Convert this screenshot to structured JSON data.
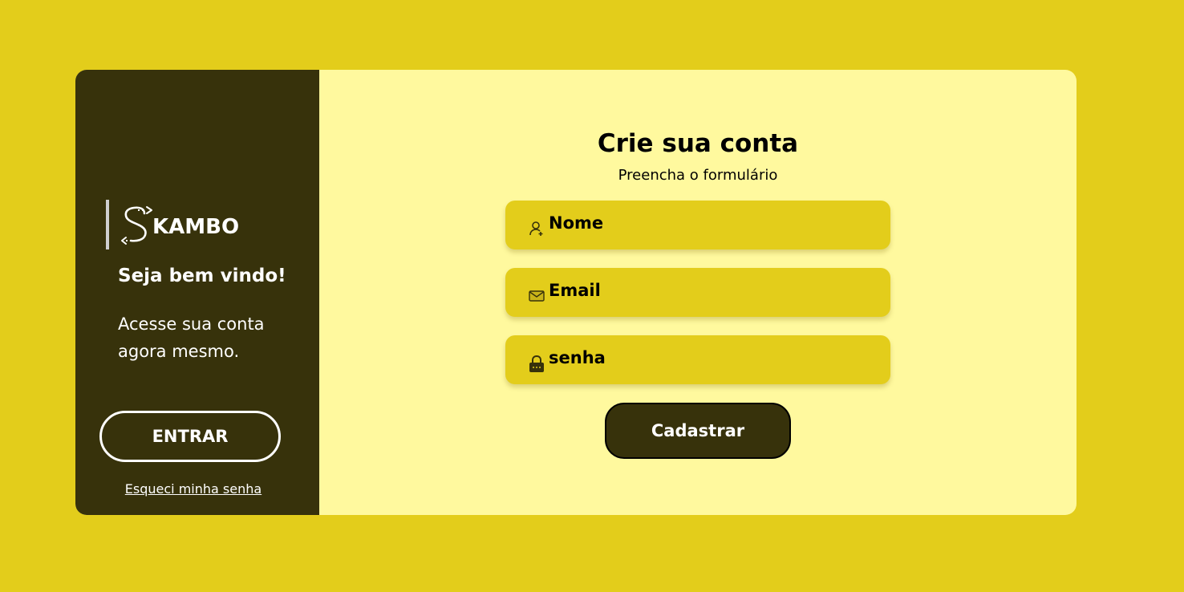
{
  "brand": {
    "logo_text": "KAMBO"
  },
  "left_panel": {
    "welcome": "Seja bem vindo!",
    "access_text": "Acesse sua conta agora mesmo.",
    "enter_label": "ENTRAR",
    "forgot_label": "Esqueci minha senha"
  },
  "form": {
    "title": "Crie sua conta",
    "subtitle": "Preencha o formulário",
    "name_placeholder": "Nome",
    "email_placeholder": "Email",
    "password_placeholder": "senha",
    "submit_label": "Cadastrar"
  },
  "colors": {
    "background": "#e3cd1b",
    "dark_panel": "#37320b",
    "form_panel": "#fff99e",
    "input_bg": "#e3cd1b"
  },
  "icons": {
    "name_field": "user-plus-icon",
    "email_field": "envelope-icon",
    "password_field": "lock-icon"
  }
}
